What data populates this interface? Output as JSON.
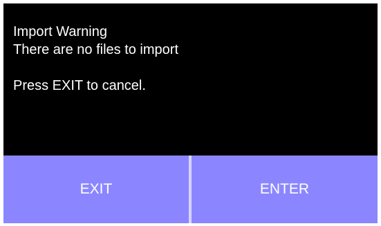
{
  "dialog": {
    "title": "Import Warning",
    "message": "There are no files to import",
    "instruction": "Press EXIT to cancel."
  },
  "buttons": {
    "exit_label": "EXIT",
    "enter_label": "ENTER"
  },
  "colors": {
    "screen_background": "#000000",
    "button_background": "#8b86ff",
    "divider": "#d6d4ff",
    "text": "#ffffff"
  }
}
